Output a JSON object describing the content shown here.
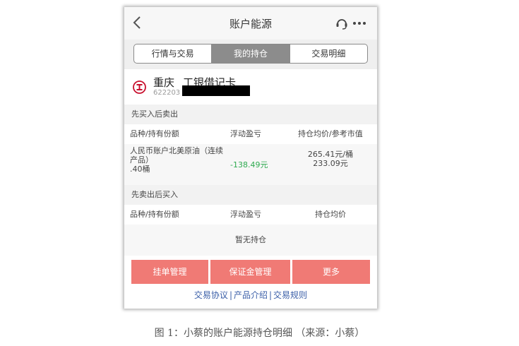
{
  "nav": {
    "title": "账户能源",
    "back_icon": "chevron-left-icon",
    "support_icon": "headset-icon",
    "more_icon": "more-dots-icon"
  },
  "tabs": [
    {
      "label": "行情与交易",
      "active": false
    },
    {
      "label": "我的持仓",
      "active": true
    },
    {
      "label": "交易明细",
      "active": false
    }
  ],
  "account": {
    "city": "重庆",
    "card_type": "工银借记卡",
    "number_prefix": "622203",
    "logo_icon": "icbc-logo-icon"
  },
  "buy_first": {
    "section_title": "先买入后卖出",
    "headers": [
      "品种/持有份额",
      "浮动盈亏",
      "持仓均价/参考市值"
    ],
    "positions": [
      {
        "name_line1": "人民币账户北美原油（连续",
        "name_line2": "产品）",
        "quantity": ".40桶",
        "pnl": "-138.49元",
        "avg_price": "265.41元/桶",
        "market_value": "233.09元"
      }
    ]
  },
  "sell_first": {
    "section_title": "先卖出后买入",
    "headers": [
      "品种/持有份额",
      "浮动盈亏",
      "持仓均价"
    ],
    "empty_text": "暂无持仓"
  },
  "actions": [
    "挂单管理",
    "保证金管理",
    "更多"
  ],
  "links": [
    "交易协议",
    "产品介绍",
    "交易规则"
  ],
  "link_separator": "|",
  "colors": {
    "accent": "#f07a75",
    "pnl_negative": "#2eaa4f",
    "link": "#3b5fa8",
    "tab_active": "#8c8c8c"
  },
  "caption": "图 1：小蔡的账户能源持仓明细 （来源：小蔡）"
}
